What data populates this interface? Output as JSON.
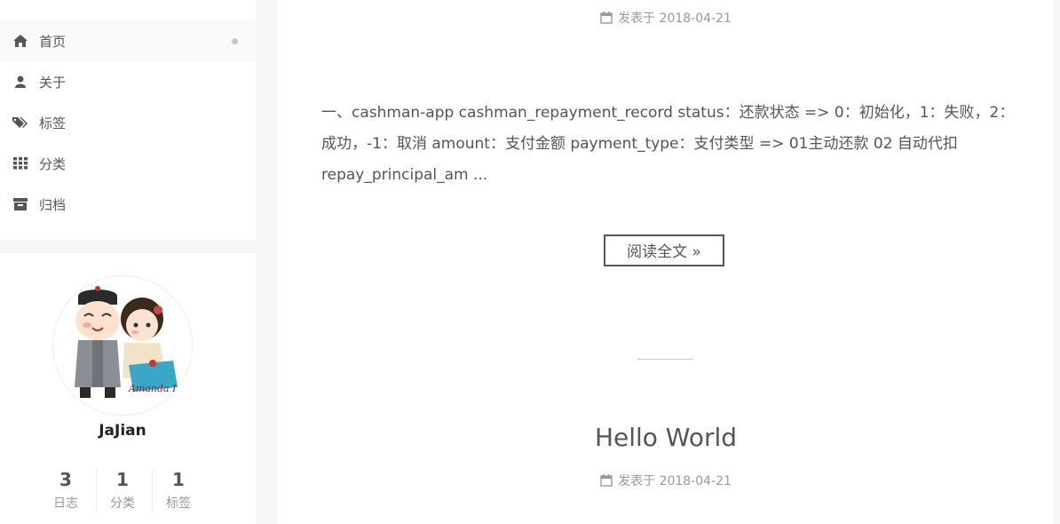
{
  "sidebar": {
    "menu": [
      {
        "label": "首页",
        "icon": "home-icon",
        "active": true
      },
      {
        "label": "关于",
        "icon": "user-icon"
      },
      {
        "label": "标签",
        "icon": "tags-icon"
      },
      {
        "label": "分类",
        "icon": "th-icon"
      },
      {
        "label": "归档",
        "icon": "archive-icon"
      }
    ],
    "author": {
      "name": "JaJian",
      "avatar_signature": "Amanda Lin",
      "stats": [
        {
          "count": "3",
          "label": "日志"
        },
        {
          "count": "1",
          "label": "分类"
        },
        {
          "count": "1",
          "label": "标签"
        }
      ]
    }
  },
  "posts": [
    {
      "meta_label": "发表于",
      "date": "2018-04-21",
      "excerpt": "一、cashman-app cashman_repayment_record status：还款状态 => 0：初始化，1：失败，2：成功，-1：取消 amount：支付金额 payment_type：支付类型 => 01主动还款 02 自动代扣 repay_principal_am ...",
      "read_more": "阅读全文 »"
    },
    {
      "title": "Hello World",
      "meta_label": "发表于",
      "date": "2018-04-21"
    }
  ],
  "colors": {
    "text": "#555555",
    "muted": "#999999",
    "background": "#f5f7f9"
  }
}
